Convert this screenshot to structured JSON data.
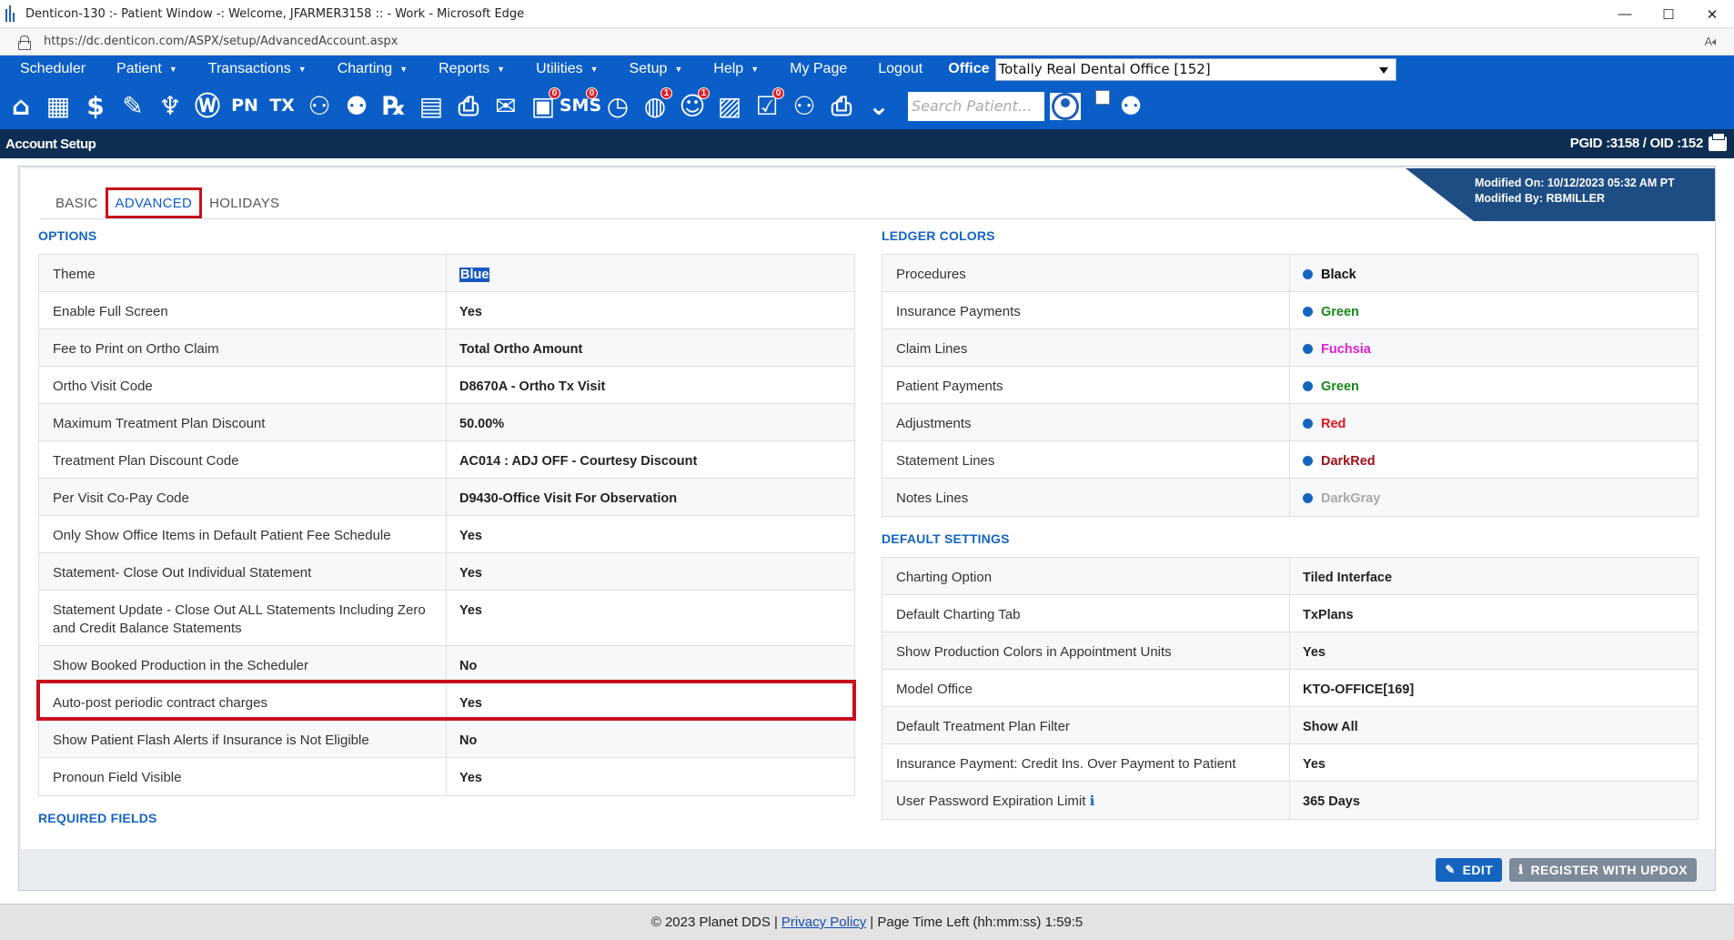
{
  "window": {
    "title": "Denticon-130 :- Patient Window -: Welcome, JFARMER3158 :: - Work - Microsoft Edge",
    "minimize": "—",
    "maximize": "☐",
    "close": "✕"
  },
  "browser": {
    "url": "https://dc.denticon.com/ASPX/setup/AdvancedAccount.aspx",
    "read_aloud": "A)"
  },
  "menu": {
    "items": [
      {
        "label": "Scheduler",
        "caret": false
      },
      {
        "label": "Patient",
        "caret": true
      },
      {
        "label": "Transactions",
        "caret": true
      },
      {
        "label": "Charting",
        "caret": true
      },
      {
        "label": "Reports",
        "caret": true
      },
      {
        "label": "Utilities",
        "caret": true
      },
      {
        "label": "Setup",
        "caret": true
      },
      {
        "label": "Help",
        "caret": true
      },
      {
        "label": "My Page",
        "caret": false
      },
      {
        "label": "Logout",
        "caret": false
      }
    ],
    "office_label": "Office",
    "office_value": "Totally Real Dental Office [152]"
  },
  "toolbar": {
    "icons": [
      {
        "name": "home-icon",
        "glyph": "⌂",
        "badge": ""
      },
      {
        "name": "calendar-icon",
        "glyph": "▦",
        "badge": ""
      },
      {
        "name": "dollar-icon",
        "glyph": "$",
        "badge": ""
      },
      {
        "name": "pencil-list-icon",
        "glyph": "✎",
        "badge": ""
      },
      {
        "name": "tooth-icon",
        "glyph": "♆",
        "badge": ""
      },
      {
        "name": "tooth-root-icon",
        "glyph": "Ⓦ",
        "badge": ""
      },
      {
        "name": "pn-icon",
        "glyph": "PN",
        "badge": ""
      },
      {
        "name": "tx-icon",
        "glyph": "TX",
        "badge": ""
      },
      {
        "name": "add-patient-icon",
        "glyph": "⚇",
        "badge": ""
      },
      {
        "name": "patient-group-icon",
        "glyph": "⚉",
        "badge": ""
      },
      {
        "name": "rx-icon",
        "glyph": "℞",
        "badge": ""
      },
      {
        "name": "chat-icon",
        "glyph": "▤",
        "badge": ""
      },
      {
        "name": "printer-doc-icon",
        "glyph": "⎙",
        "badge": ""
      },
      {
        "name": "mail-icon",
        "glyph": "✉",
        "badge": ""
      },
      {
        "name": "image-icon",
        "glyph": "▣",
        "badge": "0"
      },
      {
        "name": "sms-icon",
        "glyph": "SMS",
        "badge": "0"
      },
      {
        "name": "clock-icon",
        "glyph": "◷",
        "badge": ""
      },
      {
        "name": "globe-icon",
        "glyph": "◍",
        "badge": "1"
      },
      {
        "name": "support-icon",
        "glyph": "☺",
        "badge": "1"
      },
      {
        "name": "photo-icon",
        "glyph": "▨",
        "badge": ""
      },
      {
        "name": "document-check-icon",
        "glyph": "☑",
        "badge": "0"
      },
      {
        "name": "people-icon",
        "glyph": "⚇",
        "badge": ""
      },
      {
        "name": "print-icon",
        "glyph": "⎙",
        "badge": ""
      },
      {
        "name": "inbox-icon",
        "glyph": "⌄",
        "badge": ""
      }
    ],
    "search_placeholder": "Search Patient..."
  },
  "page": {
    "title": "Account Setup",
    "ids": "PGID :3158  /  OID :152"
  },
  "tabs": [
    {
      "label": "BASIC",
      "active": false
    },
    {
      "label": "ADVANCED",
      "active": true
    },
    {
      "label": "HOLIDAYS",
      "active": false
    }
  ],
  "modified": {
    "on": "Modified On: 10/12/2023 05:32 AM PT",
    "by": "Modified By: RBMILLER"
  },
  "options": {
    "title": "OPTIONS",
    "rows": [
      {
        "label": "Theme",
        "value": "Blue"
      },
      {
        "label": "Enable Full Screen",
        "value": "Yes"
      },
      {
        "label": "Fee to Print on Ortho Claim",
        "value": "Total Ortho Amount"
      },
      {
        "label": "Ortho Visit Code",
        "value": "D8670A - Ortho Tx Visit"
      },
      {
        "label": "Maximum Treatment Plan Discount",
        "value": "50.00%"
      },
      {
        "label": "Treatment Plan Discount Code",
        "value": "AC014 : ADJ OFF - Courtesy Discount"
      },
      {
        "label": "Per Visit Co-Pay Code",
        "value": "D9430-Office Visit For Observation"
      },
      {
        "label": "Only Show Office Items in Default Patient Fee Schedule",
        "value": "Yes"
      },
      {
        "label": "Statement- Close Out Individual Statement",
        "value": "Yes"
      },
      {
        "label": "Statement Update - Close Out ALL Statements Including Zero and Credit Balance Statements",
        "value": "Yes"
      },
      {
        "label": "Show Booked Production in the Scheduler",
        "value": "No"
      },
      {
        "label": "Auto-post periodic contract charges",
        "value": "Yes"
      },
      {
        "label": "Show Patient Flash Alerts if Insurance is Not Eligible",
        "value": "No"
      },
      {
        "label": "Pronoun Field Visible",
        "value": "Yes"
      }
    ]
  },
  "required_fields": {
    "title": "REQUIRED FIELDS"
  },
  "ledger_colors": {
    "title": "LEDGER COLORS",
    "rows": [
      {
        "label": "Procedures",
        "value": "Black",
        "color": "#111111"
      },
      {
        "label": "Insurance Payments",
        "value": "Green",
        "color": "#168a16"
      },
      {
        "label": "Claim Lines",
        "value": "Fuchsia",
        "color": "#e020d0"
      },
      {
        "label": "Patient Payments",
        "value": "Green",
        "color": "#168a16"
      },
      {
        "label": "Adjustments",
        "value": "Red",
        "color": "#e0161c"
      },
      {
        "label": "Statement Lines",
        "value": "DarkRed",
        "color": "#a0101a"
      },
      {
        "label": "Notes Lines",
        "value": "DarkGray",
        "color": "#a9a9a9"
      }
    ]
  },
  "default_settings": {
    "title": "DEFAULT SETTINGS",
    "rows": [
      {
        "label": "Charting Option",
        "value": "Tiled Interface"
      },
      {
        "label": "Default Charting Tab",
        "value": "TxPlans"
      },
      {
        "label": "Show Production Colors in Appointment Units",
        "value": "Yes"
      },
      {
        "label": "Model Office",
        "value": "KTO-OFFICE[169]"
      },
      {
        "label": "Default Treatment Plan Filter",
        "value": "Show All"
      },
      {
        "label": "Insurance Payment: Credit Ins. Over Payment to Patient",
        "value": "Yes"
      },
      {
        "label": "User Password Expiration Limit",
        "value": "365 Days"
      }
    ]
  },
  "actions": {
    "edit": "EDIT",
    "register": "REGISTER WITH UPDOX"
  },
  "footer": {
    "copyright": "© 2023 Planet DDS |",
    "privacy": "Privacy Policy",
    "time_left": "|  Page Time Left (hh:mm:ss) 1:59:5"
  },
  "colors": {
    "menu_bg": "#0b5ec7",
    "page_header_bg": "#0e2d53",
    "accent": "#1565c0",
    "highlight_box": "#c80f1d"
  }
}
